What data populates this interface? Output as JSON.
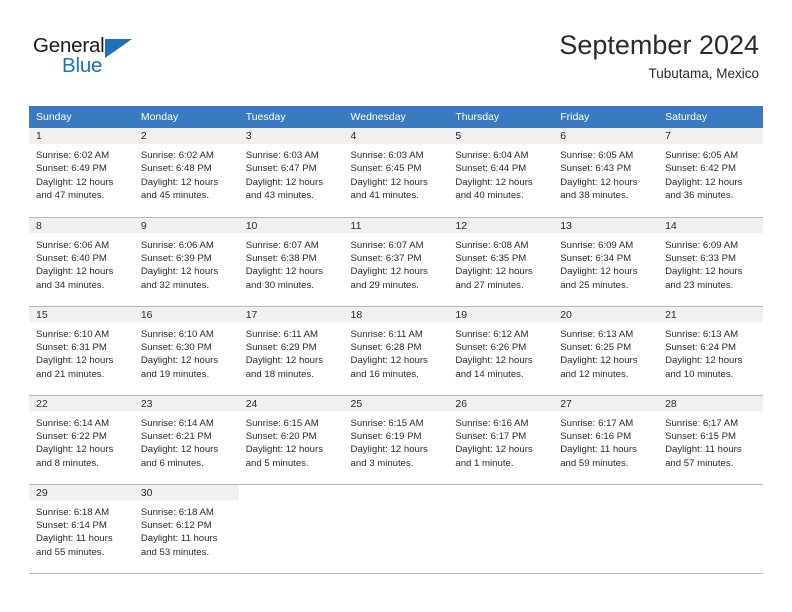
{
  "brand": {
    "name_part1": "General",
    "name_part2": "Blue",
    "triangle_color": "#1e72bd"
  },
  "header": {
    "title": "September 2024",
    "subtitle": "Tubutama, Mexico",
    "header_bg_color": "#3a7ac0",
    "header_text_color": "#ffffff"
  },
  "weekday_headers": [
    "Sunday",
    "Monday",
    "Tuesday",
    "Wednesday",
    "Thursday",
    "Friday",
    "Saturday"
  ],
  "weeks": [
    [
      {
        "day": "1",
        "sunrise": "Sunrise: 6:02 AM",
        "sunset": "Sunset: 6:49 PM",
        "daylight1": "Daylight: 12 hours",
        "daylight2": "and 47 minutes."
      },
      {
        "day": "2",
        "sunrise": "Sunrise: 6:02 AM",
        "sunset": "Sunset: 6:48 PM",
        "daylight1": "Daylight: 12 hours",
        "daylight2": "and 45 minutes."
      },
      {
        "day": "3",
        "sunrise": "Sunrise: 6:03 AM",
        "sunset": "Sunset: 6:47 PM",
        "daylight1": "Daylight: 12 hours",
        "daylight2": "and 43 minutes."
      },
      {
        "day": "4",
        "sunrise": "Sunrise: 6:03 AM",
        "sunset": "Sunset: 6:45 PM",
        "daylight1": "Daylight: 12 hours",
        "daylight2": "and 41 minutes."
      },
      {
        "day": "5",
        "sunrise": "Sunrise: 6:04 AM",
        "sunset": "Sunset: 6:44 PM",
        "daylight1": "Daylight: 12 hours",
        "daylight2": "and 40 minutes."
      },
      {
        "day": "6",
        "sunrise": "Sunrise: 6:05 AM",
        "sunset": "Sunset: 6:43 PM",
        "daylight1": "Daylight: 12 hours",
        "daylight2": "and 38 minutes."
      },
      {
        "day": "7",
        "sunrise": "Sunrise: 6:05 AM",
        "sunset": "Sunset: 6:42 PM",
        "daylight1": "Daylight: 12 hours",
        "daylight2": "and 36 minutes."
      }
    ],
    [
      {
        "day": "8",
        "sunrise": "Sunrise: 6:06 AM",
        "sunset": "Sunset: 6:40 PM",
        "daylight1": "Daylight: 12 hours",
        "daylight2": "and 34 minutes."
      },
      {
        "day": "9",
        "sunrise": "Sunrise: 6:06 AM",
        "sunset": "Sunset: 6:39 PM",
        "daylight1": "Daylight: 12 hours",
        "daylight2": "and 32 minutes."
      },
      {
        "day": "10",
        "sunrise": "Sunrise: 6:07 AM",
        "sunset": "Sunset: 6:38 PM",
        "daylight1": "Daylight: 12 hours",
        "daylight2": "and 30 minutes."
      },
      {
        "day": "11",
        "sunrise": "Sunrise: 6:07 AM",
        "sunset": "Sunset: 6:37 PM",
        "daylight1": "Daylight: 12 hours",
        "daylight2": "and 29 minutes."
      },
      {
        "day": "12",
        "sunrise": "Sunrise: 6:08 AM",
        "sunset": "Sunset: 6:35 PM",
        "daylight1": "Daylight: 12 hours",
        "daylight2": "and 27 minutes."
      },
      {
        "day": "13",
        "sunrise": "Sunrise: 6:09 AM",
        "sunset": "Sunset: 6:34 PM",
        "daylight1": "Daylight: 12 hours",
        "daylight2": "and 25 minutes."
      },
      {
        "day": "14",
        "sunrise": "Sunrise: 6:09 AM",
        "sunset": "Sunset: 6:33 PM",
        "daylight1": "Daylight: 12 hours",
        "daylight2": "and 23 minutes."
      }
    ],
    [
      {
        "day": "15",
        "sunrise": "Sunrise: 6:10 AM",
        "sunset": "Sunset: 6:31 PM",
        "daylight1": "Daylight: 12 hours",
        "daylight2": "and 21 minutes."
      },
      {
        "day": "16",
        "sunrise": "Sunrise: 6:10 AM",
        "sunset": "Sunset: 6:30 PM",
        "daylight1": "Daylight: 12 hours",
        "daylight2": "and 19 minutes."
      },
      {
        "day": "17",
        "sunrise": "Sunrise: 6:11 AM",
        "sunset": "Sunset: 6:29 PM",
        "daylight1": "Daylight: 12 hours",
        "daylight2": "and 18 minutes."
      },
      {
        "day": "18",
        "sunrise": "Sunrise: 6:11 AM",
        "sunset": "Sunset: 6:28 PM",
        "daylight1": "Daylight: 12 hours",
        "daylight2": "and 16 minutes."
      },
      {
        "day": "19",
        "sunrise": "Sunrise: 6:12 AM",
        "sunset": "Sunset: 6:26 PM",
        "daylight1": "Daylight: 12 hours",
        "daylight2": "and 14 minutes."
      },
      {
        "day": "20",
        "sunrise": "Sunrise: 6:13 AM",
        "sunset": "Sunset: 6:25 PM",
        "daylight1": "Daylight: 12 hours",
        "daylight2": "and 12 minutes."
      },
      {
        "day": "21",
        "sunrise": "Sunrise: 6:13 AM",
        "sunset": "Sunset: 6:24 PM",
        "daylight1": "Daylight: 12 hours",
        "daylight2": "and 10 minutes."
      }
    ],
    [
      {
        "day": "22",
        "sunrise": "Sunrise: 6:14 AM",
        "sunset": "Sunset: 6:22 PM",
        "daylight1": "Daylight: 12 hours",
        "daylight2": "and 8 minutes."
      },
      {
        "day": "23",
        "sunrise": "Sunrise: 6:14 AM",
        "sunset": "Sunset: 6:21 PM",
        "daylight1": "Daylight: 12 hours",
        "daylight2": "and 6 minutes."
      },
      {
        "day": "24",
        "sunrise": "Sunrise: 6:15 AM",
        "sunset": "Sunset: 6:20 PM",
        "daylight1": "Daylight: 12 hours",
        "daylight2": "and 5 minutes."
      },
      {
        "day": "25",
        "sunrise": "Sunrise: 6:15 AM",
        "sunset": "Sunset: 6:19 PM",
        "daylight1": "Daylight: 12 hours",
        "daylight2": "and 3 minutes."
      },
      {
        "day": "26",
        "sunrise": "Sunrise: 6:16 AM",
        "sunset": "Sunset: 6:17 PM",
        "daylight1": "Daylight: 12 hours",
        "daylight2": "and 1 minute."
      },
      {
        "day": "27",
        "sunrise": "Sunrise: 6:17 AM",
        "sunset": "Sunset: 6:16 PM",
        "daylight1": "Daylight: 11 hours",
        "daylight2": "and 59 minutes."
      },
      {
        "day": "28",
        "sunrise": "Sunrise: 6:17 AM",
        "sunset": "Sunset: 6:15 PM",
        "daylight1": "Daylight: 11 hours",
        "daylight2": "and 57 minutes."
      }
    ],
    [
      {
        "day": "29",
        "sunrise": "Sunrise: 6:18 AM",
        "sunset": "Sunset: 6:14 PM",
        "daylight1": "Daylight: 11 hours",
        "daylight2": "and 55 minutes."
      },
      {
        "day": "30",
        "sunrise": "Sunrise: 6:18 AM",
        "sunset": "Sunset: 6:12 PM",
        "daylight1": "Daylight: 11 hours",
        "daylight2": "and 53 minutes."
      },
      null,
      null,
      null,
      null,
      null
    ]
  ]
}
